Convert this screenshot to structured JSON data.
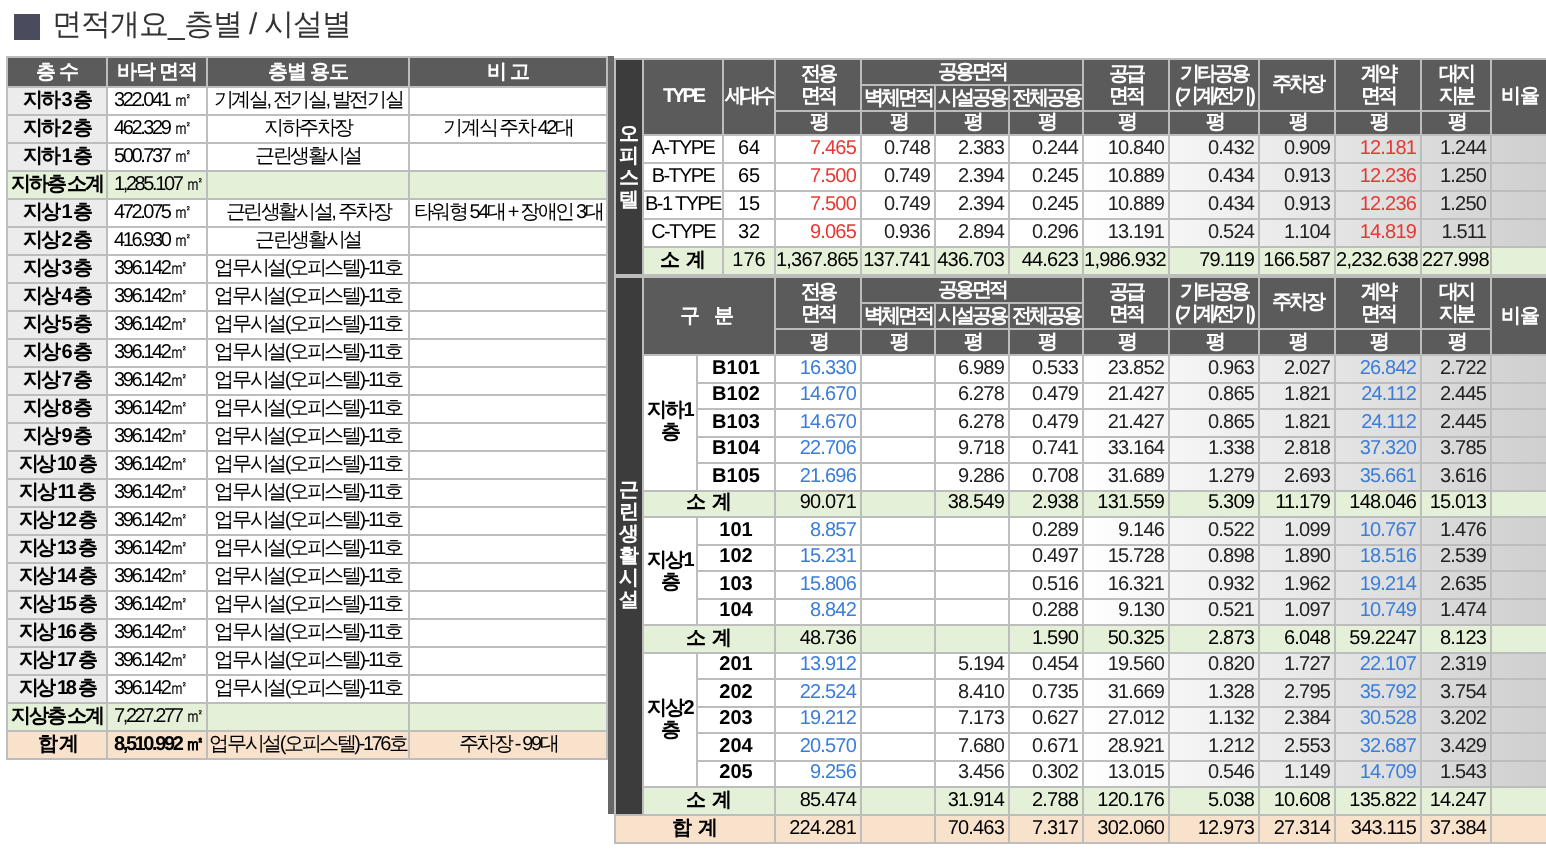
{
  "left": {
    "title": "면적개요_층별 / 시설별",
    "columns": [
      "층 수",
      "바닥 면적",
      "층별 용도",
      "비 고"
    ],
    "rows": [
      {
        "kind": "floor",
        "cells": [
          "지하 3 층",
          "322.041 ㎡",
          "기계실, 전기실, 발전기실"
        ]
      },
      {
        "kind": "floor",
        "cells": [
          "지하 2 층",
          "462.329 ㎡",
          "지하주차장",
          "기계식 주차 42대"
        ]
      },
      {
        "kind": "floor",
        "cells": [
          "지하 1 층",
          "500.737 ㎡",
          "근린생활시설"
        ]
      },
      {
        "kind": "subtotal",
        "cells": [
          "지하층 소계",
          "1,285.107 ㎡"
        ]
      },
      {
        "kind": "floor",
        "cells": [
          "지상 1 층",
          "472.075 ㎡",
          "근린생활시설, 주차장",
          "타워형 54대 + 장애인 3대"
        ]
      },
      {
        "kind": "floor",
        "cells": [
          "지상 2 층",
          "416.930 ㎡",
          "근린생활시설"
        ]
      },
      {
        "kind": "floor",
        "cells": [
          "지상 3 층",
          "396.142㎡",
          "업무시설(오피스텔)-11호"
        ]
      },
      {
        "kind": "floor",
        "cells": [
          "지상 4 층",
          "396.142㎡",
          "업무시설(오피스텔)-11호"
        ]
      },
      {
        "kind": "floor",
        "cells": [
          "지상 5 층",
          "396.142㎡",
          "업무시설(오피스텔)-11호"
        ]
      },
      {
        "kind": "floor",
        "cells": [
          "지상 6 층",
          "396.142㎡",
          "업무시설(오피스텔)-11호"
        ]
      },
      {
        "kind": "floor",
        "cells": [
          "지상 7 층",
          "396.142㎡",
          "업무시설(오피스텔)-11호"
        ]
      },
      {
        "kind": "floor",
        "cells": [
          "지상 8 층",
          "396.142㎡",
          "업무시설(오피스텔)-11호"
        ]
      },
      {
        "kind": "floor",
        "cells": [
          "지상 9 층",
          "396.142㎡",
          "업무시설(오피스텔)-11호"
        ]
      },
      {
        "kind": "floor",
        "cells": [
          "지상 10 층",
          "396.142㎡",
          "업무시설(오피스텔)-11호"
        ]
      },
      {
        "kind": "floor",
        "cells": [
          "지상 11 층",
          "396.142㎡",
          "업무시설(오피스텔)-11호"
        ]
      },
      {
        "kind": "floor",
        "cells": [
          "지상 12 층",
          "396.142㎡",
          "업무시설(오피스텔)-11호"
        ]
      },
      {
        "kind": "floor",
        "cells": [
          "지상 13 층",
          "396.142㎡",
          "업무시설(오피스텔)-11호"
        ]
      },
      {
        "kind": "floor",
        "cells": [
          "지상 14 층",
          "396.142㎡",
          "업무시설(오피스텔)-11호"
        ]
      },
      {
        "kind": "floor",
        "cells": [
          "지상 15 층",
          "396.142㎡",
          "업무시설(오피스텔)-11호"
        ]
      },
      {
        "kind": "floor",
        "cells": [
          "지상 16 층",
          "396.142㎡",
          "업무시설(오피스텔)-11호"
        ]
      },
      {
        "kind": "floor",
        "cells": [
          "지상 17 층",
          "396.142㎡",
          "업무시설(오피스텔)-11호"
        ]
      },
      {
        "kind": "floor",
        "cells": [
          "지상 18 층",
          "396.142㎡",
          "업무시설(오피스텔)-11호"
        ]
      },
      {
        "kind": "subtotal",
        "cells": [
          "지상층 소계",
          "7,227.277 ㎡"
        ]
      },
      {
        "kind": "total",
        "cells": [
          "합 계",
          "8,510.992 ㎡",
          "업무시설(오피스텔)-176호",
          "주차장 - 99대"
        ]
      }
    ]
  },
  "office": {
    "side_label": "오피스텔",
    "type_label": "TYPE",
    "units_label": "세대수",
    "columns": [
      {
        "kind": "single",
        "lines": [
          "전용",
          "면적"
        ],
        "unit": "평",
        "accent": true
      },
      {
        "kind": "group",
        "label": "공용면적",
        "columns": [
          {
            "lines": [
              "벽체면적"
            ],
            "unit": "평",
            "accent": false
          },
          {
            "lines": [
              "시설공용"
            ],
            "unit": "평",
            "accent": false
          },
          {
            "lines": [
              "전체공용"
            ],
            "unit": "평",
            "accent": false
          }
        ]
      },
      {
        "kind": "single",
        "lines": [
          "공급",
          "면적"
        ],
        "unit": "평",
        "accent": false
      },
      {
        "kind": "single",
        "lines": [
          "기타공용",
          "(기계/전기)"
        ],
        "unit": "평",
        "accent": false
      },
      {
        "kind": "single",
        "lines": [
          "주차장"
        ],
        "unit": "평",
        "accent": false
      },
      {
        "kind": "single",
        "lines": [
          "계약",
          "면적"
        ],
        "unit": "평",
        "accent": true
      },
      {
        "kind": "single",
        "lines": [
          "대지",
          "지분"
        ],
        "unit": "평",
        "accent": false
      },
      {
        "kind": "single",
        "lines": [
          "비 율"
        ]
      }
    ],
    "rows": [
      {
        "type": "A-TYPE",
        "units": "64",
        "values": {
          "exclusive_area": "7.465",
          "wall_area": "0.748",
          "facility_common": "2.383",
          "total_common": "0.244",
          "supply_area": "10.840",
          "other_common": "0.432",
          "parking": "0.909",
          "contract_area": "12.181",
          "land_share": "1.244"
        }
      },
      {
        "type": "B-TYPE",
        "units": "65",
        "values": {
          "exclusive_area": "7.500",
          "wall_area": "0.749",
          "facility_common": "2.394",
          "total_common": "0.245",
          "supply_area": "10.889",
          "other_common": "0.434",
          "parking": "0.913",
          "contract_area": "12.236",
          "land_share": "1.250"
        }
      },
      {
        "type": "B-1 TYPE",
        "units": "15",
        "values": {
          "exclusive_area": "7.500",
          "wall_area": "0.749",
          "facility_common": "2.394",
          "total_common": "0.245",
          "supply_area": "10.889",
          "other_common": "0.434",
          "parking": "0.913",
          "contract_area": "12.236",
          "land_share": "1.250"
        }
      },
      {
        "type": "C-TYPE",
        "units": "32",
        "values": {
          "exclusive_area": "9.065",
          "wall_area": "0.936",
          "facility_common": "2.894",
          "total_common": "0.296",
          "supply_area": "13.191",
          "other_common": "0.524",
          "parking": "1.104",
          "contract_area": "14.819",
          "land_share": "1.511"
        }
      }
    ],
    "subtotal": {
      "label": "소 계",
      "units": "176",
      "values": {
        "exclusive_area": "1,367.865",
        "wall_area": "137.741",
        "facility_common": "436.703",
        "total_common": "44.623",
        "supply_area": "1,986.932",
        "other_common": "79.119",
        "parking": "166.587",
        "contract_area": "2,232.638",
        "land_share": "227.998"
      }
    }
  },
  "retail": {
    "side_label": "근린생활시설",
    "category_label": "구 분",
    "columns": [
      {
        "kind": "single",
        "lines": [
          "전용",
          "면적"
        ],
        "unit": "평",
        "accent": true
      },
      {
        "kind": "group",
        "label": "공용면적",
        "columns": [
          {
            "lines": [
              "벽체면적"
            ],
            "unit": "평"
          },
          {
            "lines": [
              "시설공용"
            ],
            "unit": "평",
            "accent": false
          },
          {
            "lines": [
              "전체공용"
            ],
            "unit": "평",
            "accent": false
          }
        ]
      },
      {
        "kind": "single",
        "lines": [
          "공급",
          "면적"
        ],
        "unit": "평",
        "accent": false
      },
      {
        "kind": "single",
        "lines": [
          "기타공용",
          "(기계/전기)"
        ],
        "unit": "평",
        "accent": false
      },
      {
        "kind": "single",
        "lines": [
          "주차장"
        ],
        "unit": "평",
        "accent": false
      },
      {
        "kind": "single",
        "lines": [
          "계약",
          "면적"
        ],
        "unit": "평",
        "accent": true
      },
      {
        "kind": "single",
        "lines": [
          "대지",
          "지분"
        ],
        "unit": "평",
        "accent": false
      },
      {
        "kind": "single",
        "lines": [
          "비 율"
        ]
      }
    ],
    "floors": [
      {
        "lines": [
          "지하1",
          "층"
        ],
        "units": [
          {
            "unit": "B101",
            "values": {
              "exclusive_area": "16.330",
              "facility_common": "6.989",
              "total_common": "0.533",
              "supply_area": "23.852",
              "other_common": "0.963",
              "parking": "2.027",
              "contract_area": "26.842",
              "land_share": "2.722"
            }
          },
          {
            "unit": "B102",
            "values": {
              "exclusive_area": "14.670",
              "facility_common": "6.278",
              "total_common": "0.479",
              "supply_area": "21.427",
              "other_common": "0.865",
              "parking": "1.821",
              "contract_area": "24.112",
              "land_share": "2.445"
            }
          },
          {
            "unit": "B103",
            "values": {
              "exclusive_area": "14.670",
              "facility_common": "6.278",
              "total_common": "0.479",
              "supply_area": "21.427",
              "other_common": "0.865",
              "parking": "1.821",
              "contract_area": "24.112",
              "land_share": "2.445"
            }
          },
          {
            "unit": "B104",
            "values": {
              "exclusive_area": "22.706",
              "facility_common": "9.718",
              "total_common": "0.741",
              "supply_area": "33.164",
              "other_common": "1.338",
              "parking": "2.818",
              "contract_area": "37.320",
              "land_share": "3.785"
            }
          },
          {
            "unit": "B105",
            "values": {
              "exclusive_area": "21.696",
              "facility_common": "9.286",
              "total_common": "0.708",
              "supply_area": "31.689",
              "other_common": "1.279",
              "parking": "2.693",
              "contract_area": "35.661",
              "land_share": "3.616"
            }
          }
        ],
        "subtotal": {
          "label": "소 계",
          "values": {
            "exclusive_area": "90.071",
            "facility_common": "38.549",
            "total_common": "2.938",
            "supply_area": "131.559",
            "other_common": "5.309",
            "parking": "11.179",
            "contract_area": "148.046",
            "land_share": "15.013"
          }
        }
      },
      {
        "lines": [
          "지상1",
          "층"
        ],
        "units": [
          {
            "unit": "101",
            "values": {
              "exclusive_area": "8.857",
              "total_common": "0.289",
              "supply_area": "9.146",
              "other_common": "0.522",
              "parking": "1.099",
              "contract_area": "10.767",
              "land_share": "1.476"
            }
          },
          {
            "unit": "102",
            "values": {
              "exclusive_area": "15.231",
              "total_common": "0.497",
              "supply_area": "15.728",
              "other_common": "0.898",
              "parking": "1.890",
              "contract_area": "18.516",
              "land_share": "2.539"
            }
          },
          {
            "unit": "103",
            "values": {
              "exclusive_area": "15.806",
              "total_common": "0.516",
              "supply_area": "16.321",
              "other_common": "0.932",
              "parking": "1.962",
              "contract_area": "19.214",
              "land_share": "2.635"
            }
          },
          {
            "unit": "104",
            "values": {
              "exclusive_area": "8.842",
              "total_common": "0.288",
              "supply_area": "9.130",
              "other_common": "0.521",
              "parking": "1.097",
              "contract_area": "10.749",
              "land_share": "1.474"
            }
          }
        ],
        "subtotal": {
          "label": "소 계",
          "values": {
            "exclusive_area": "48.736",
            "total_common": "1.590",
            "supply_area": "50.325",
            "other_common": "2.873",
            "parking": "6.048",
            "contract_area": "59.2247",
            "land_share": "8.123"
          }
        }
      },
      {
        "lines": [
          "지상2",
          "층"
        ],
        "units": [
          {
            "unit": "201",
            "values": {
              "exclusive_area": "13.912",
              "facility_common": "5.194",
              "total_common": "0.454",
              "supply_area": "19.560",
              "other_common": "0.820",
              "parking": "1.727",
              "contract_area": "22.107",
              "land_share": "2.319"
            }
          },
          {
            "unit": "202",
            "values": {
              "exclusive_area": "22.524",
              "facility_common": "8.410",
              "total_common": "0.735",
              "supply_area": "31.669",
              "other_common": "1.328",
              "parking": "2.795",
              "contract_area": "35.792",
              "land_share": "3.754"
            }
          },
          {
            "unit": "203",
            "values": {
              "exclusive_area": "19.212",
              "facility_common": "7.173",
              "total_common": "0.627",
              "supply_area": "27.012",
              "other_common": "1.132",
              "parking": "2.384",
              "contract_area": "30.528",
              "land_share": "3.202"
            }
          },
          {
            "unit": "204",
            "values": {
              "exclusive_area": "20.570",
              "facility_common": "7.680",
              "total_common": "0.671",
              "supply_area": "28.921",
              "other_common": "1.212",
              "parking": "2.553",
              "contract_area": "32.687",
              "land_share": "3.429"
            }
          },
          {
            "unit": "205",
            "values": {
              "exclusive_area": "9.256",
              "facility_common": "3.456",
              "total_common": "0.302",
              "supply_area": "13.015",
              "other_common": "0.546",
              "parking": "1.149",
              "contract_area": "14.709",
              "land_share": "1.543"
            }
          }
        ],
        "subtotal": {
          "label": "소 계",
          "values": {
            "exclusive_area": "85.474",
            "facility_common": "31.914",
            "total_common": "2.788",
            "supply_area": "120.176",
            "other_common": "5.038",
            "parking": "10.608",
            "contract_area": "135.822",
            "land_share": "14.247"
          }
        }
      }
    ],
    "total": {
      "label": "합 계",
      "values": {
        "exclusive_area": "224.281",
        "facility_common": "70.463",
        "total_common": "7.317",
        "supply_area": "302.060",
        "other_common": "12.973",
        "parking": "27.314",
        "contract_area": "343.115",
        "land_share": "37.384"
      }
    }
  }
}
